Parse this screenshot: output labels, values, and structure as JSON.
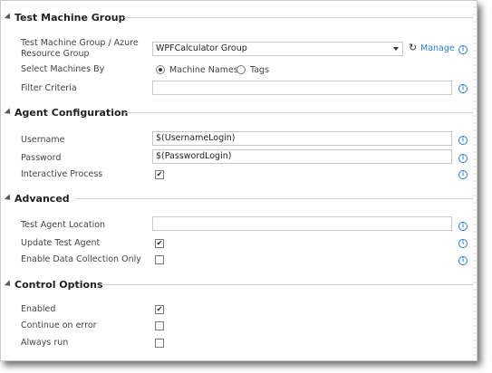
{
  "sections": {
    "test_machine_group": {
      "title": "Test Machine Group",
      "group_label_line1": "Test Machine Group / Azure",
      "group_label_line2": "Resource Group",
      "group_value": "WPFCalculator Group",
      "manage_label": "Manage",
      "select_by_label": "Select Machines By",
      "radio_machine_names": "Machine Names",
      "radio_tags": "Tags",
      "filter_label": "Filter Criteria",
      "filter_value": ""
    },
    "agent_configuration": {
      "title": "Agent Configuration",
      "username_label": "Username",
      "username_value": "$(UsernameLogin)",
      "password_label": "Password",
      "password_value": "$(PasswordLogin)",
      "interactive_label": "Interactive Process"
    },
    "advanced": {
      "title": "Advanced",
      "location_label": "Test Agent Location",
      "location_value": "",
      "update_label": "Update Test Agent",
      "enable_data_label": "Enable Data Collection Only"
    },
    "control_options": {
      "title": "Control Options",
      "enabled_label": "Enabled",
      "continue_label": "Continue on error",
      "always_run_label": "Always run"
    }
  },
  "checks": {
    "interactive_process": true,
    "update_test_agent": true,
    "enable_data_collection_only": false,
    "enabled": true,
    "continue_on_error": false,
    "always_run": false
  },
  "icons": {
    "check_glyph": "✔",
    "info_glyph": "i",
    "refresh_glyph": "↻"
  },
  "colors": {
    "link": "#2f7fd1"
  }
}
